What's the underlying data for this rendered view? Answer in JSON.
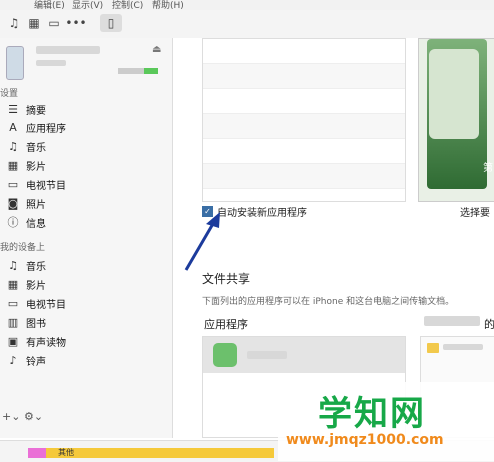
{
  "menu": [
    "编辑(E)",
    "显示(V)",
    "控制(C)",
    "帮助(H)"
  ],
  "sidebar": {
    "section_settings": "设置",
    "settings_items": [
      {
        "label": "摘要",
        "icon": "list-icon"
      },
      {
        "label": "应用程序",
        "icon": "app-store-icon"
      },
      {
        "label": "音乐",
        "icon": "music-note-icon"
      },
      {
        "label": "影片",
        "icon": "film-icon"
      },
      {
        "label": "电视节目",
        "icon": "tv-icon"
      },
      {
        "label": "照片",
        "icon": "camera-icon"
      },
      {
        "label": "信息",
        "icon": "info-icon"
      }
    ],
    "section_on_device": "我的设备上",
    "device_items": [
      {
        "label": "音乐",
        "icon": "music-note-icon"
      },
      {
        "label": "影片",
        "icon": "film-icon"
      },
      {
        "label": "电视节目",
        "icon": "tv-icon"
      },
      {
        "label": "图书",
        "icon": "book-icon"
      },
      {
        "label": "有声读物",
        "icon": "audiobook-icon"
      },
      {
        "label": "铃声",
        "icon": "bell-icon"
      }
    ],
    "footer_add": "+⌄",
    "footer_gear": "⚙⌄"
  },
  "main": {
    "auto_install_label": "自动安装新应用程序",
    "auto_install_checked": true,
    "select_label": "选择要",
    "preview_partial": "第",
    "file_sharing_title": "文件共享",
    "file_sharing_desc": "下面列出的应用程序可以在 iPhone 和这台电脑之间传输文档。",
    "apps_column_title": "应用程序",
    "docs_column_partial": "的"
  },
  "storage": {
    "label": "其他"
  },
  "watermark": {
    "main": "学知网",
    "url": "www.jmqz1000.com"
  },
  "colors": {
    "accent": "#3a6ea5",
    "storage_other": "#f5c93a",
    "storage_pink": "#ea6fd6",
    "watermark_green": "#17a848",
    "watermark_orange": "#f08a1c"
  }
}
